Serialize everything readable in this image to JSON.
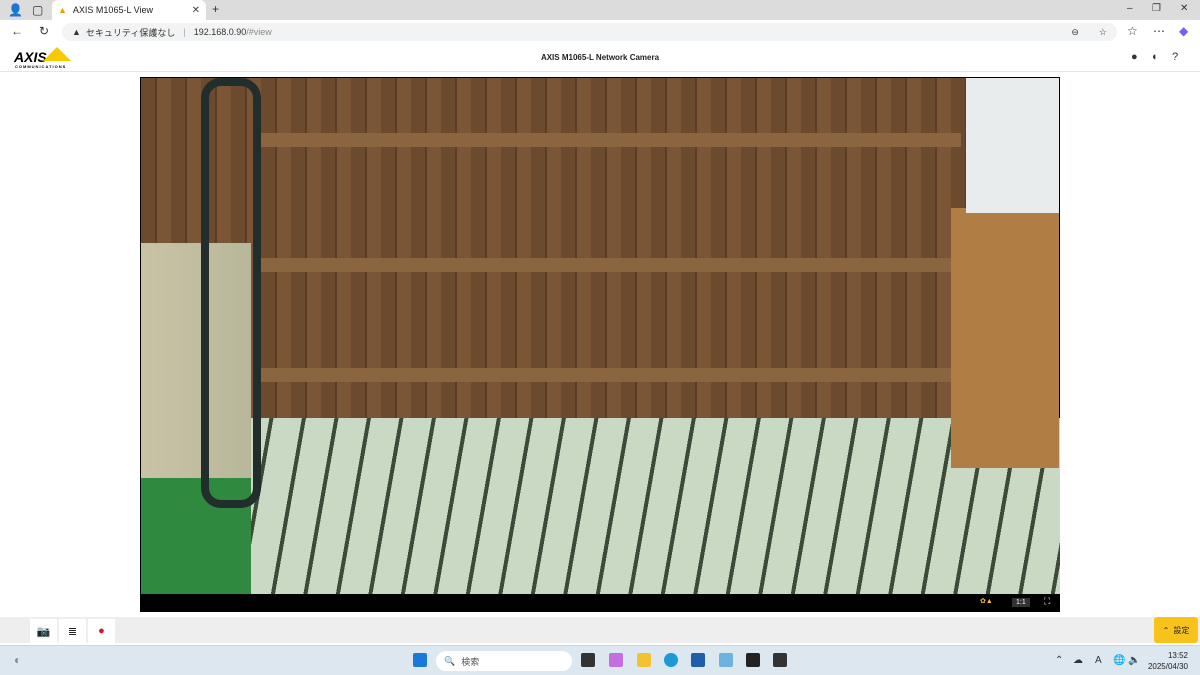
{
  "browser": {
    "tab_title": "AXIS M1065-L View",
    "security_label": "セキュリティ保護なし",
    "url_host": "192.168.0.90",
    "url_path": "/#view"
  },
  "app": {
    "logo": "AXIS",
    "logo_sub": "COMMUNICATIONS",
    "title": "AXIS M1065-L Network Camera"
  },
  "video": {
    "zoom_label": "1:1"
  },
  "toolbar": {
    "settings_label": "設定"
  },
  "taskbar": {
    "search_placeholder": "検索",
    "time": "13:52",
    "date": "2025/04/30",
    "ime": "A"
  }
}
